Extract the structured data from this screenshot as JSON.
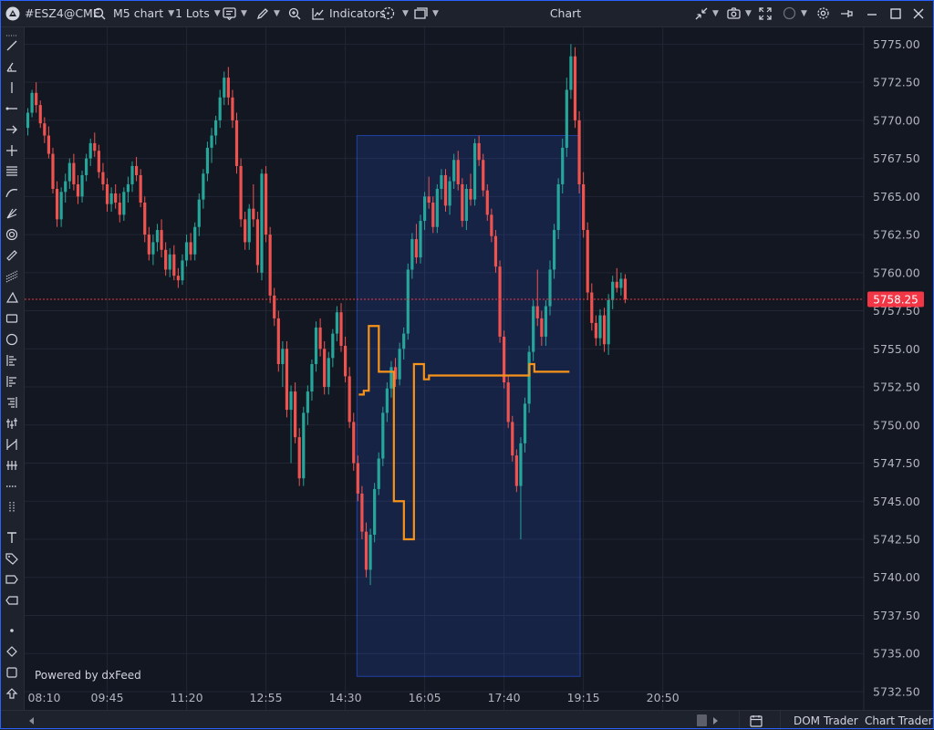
{
  "toolbar": {
    "symbol": "#ESZ4@CME",
    "timeframe": "M5 chart",
    "lots": "1 Lots",
    "indicators": "Indicators",
    "title": "Chart"
  },
  "chart": {
    "last_price_label": "5758.25",
    "powered_by": "Powered by dxFeed"
  },
  "bottom": {
    "dom_trader": "DOM Trader",
    "chart_trader": "Chart Trader"
  },
  "colors": {
    "background": "#131722",
    "up_candle": "#26a69a",
    "down_candle": "#ef5350",
    "highlight_box": "#2962ff",
    "vwap_line": "#f7931a",
    "price_line": "#f23645"
  },
  "icons": [
    "app-logo-icon",
    "search-icon",
    "chevron-down-icon",
    "object-tree-icon",
    "pencil-icon",
    "zoom-icon",
    "indicators-icon",
    "crosshair-icon",
    "layout-icon",
    "collapse-icon",
    "camera-icon",
    "fullscreen-icon",
    "circle-icon",
    "settings-icon",
    "pin-icon",
    "minimize-icon",
    "maximize-icon",
    "close-icon",
    "calendar-icon",
    "scroll-left-icon",
    "scroll-right-icon"
  ],
  "chart_data": {
    "type": "candlestick",
    "y_ticks": [
      "5775.00",
      "5772.50",
      "5770.00",
      "5767.50",
      "5765.00",
      "5762.50",
      "5760.00",
      "5757.50",
      "5755.00",
      "5752.50",
      "5750.00",
      "5747.50",
      "5745.00",
      "5742.50",
      "5740.00",
      "5737.50",
      "5735.00",
      "5732.50"
    ],
    "x_ticks": [
      "08:10",
      "09:45",
      "11:20",
      "12:55",
      "14:30",
      "16:05",
      "17:40",
      "19:15",
      "20:50"
    ],
    "ylim": [
      5731.3,
      5776.1
    ],
    "last_price": 5758.25,
    "highlight_range": {
      "x_start": "14:35",
      "x_end": "19:00",
      "y_top": 5769.0,
      "y_bottom": 5733.5
    },
    "vwap_steps": [
      [
        0,
        5752.0
      ],
      [
        1,
        5752.25
      ],
      [
        2,
        5756.5
      ],
      [
        3,
        5756.5
      ],
      [
        4,
        5753.5
      ],
      [
        6,
        5753.5
      ],
      [
        7,
        5745.0
      ],
      [
        8,
        5745.0
      ],
      [
        9,
        5742.5
      ],
      [
        10,
        5742.5
      ],
      [
        11,
        5754.0
      ],
      [
        12,
        5754.0
      ],
      [
        13,
        5753.0
      ],
      [
        14,
        5753.25
      ],
      [
        17,
        5753.25
      ],
      [
        33,
        5753.25
      ],
      [
        34,
        5754.0
      ],
      [
        35,
        5753.5
      ],
      [
        42,
        5753.5
      ]
    ],
    "vwap_start_index": 121,
    "candles": [
      [
        5769.5,
        5770.8,
        5769.0,
        5770.5
      ],
      [
        5770.5,
        5772.0,
        5770.2,
        5771.8
      ],
      [
        5771.8,
        5772.5,
        5770.5,
        5771.0
      ],
      [
        5771.0,
        5771.3,
        5769.5,
        5769.8
      ],
      [
        5769.8,
        5770.2,
        5768.5,
        5769.0
      ],
      [
        5769.0,
        5769.6,
        5767.5,
        5767.8
      ],
      [
        5767.8,
        5768.2,
        5765.2,
        5765.5
      ],
      [
        5765.5,
        5766.0,
        5763.0,
        5763.5
      ],
      [
        5763.5,
        5765.6,
        5763.0,
        5765.3
      ],
      [
        5765.3,
        5766.5,
        5764.6,
        5766.0
      ],
      [
        5766.0,
        5767.5,
        5765.5,
        5767.2
      ],
      [
        5767.2,
        5767.8,
        5765.4,
        5765.8
      ],
      [
        5765.8,
        5766.4,
        5764.5,
        5765.0
      ],
      [
        5765.0,
        5766.7,
        5764.6,
        5766.4
      ],
      [
        5766.4,
        5767.8,
        5766.0,
        5767.5
      ],
      [
        5767.5,
        5768.8,
        5767.0,
        5768.5
      ],
      [
        5768.5,
        5769.2,
        5767.6,
        5768.0
      ],
      [
        5768.0,
        5768.4,
        5766.2,
        5766.6
      ],
      [
        5766.6,
        5767.2,
        5765.4,
        5765.8
      ],
      [
        5765.8,
        5766.2,
        5764.0,
        5764.5
      ],
      [
        5764.5,
        5765.6,
        5764.0,
        5765.2
      ],
      [
        5765.2,
        5765.8,
        5764.2,
        5764.6
      ],
      [
        5764.6,
        5765.2,
        5763.3,
        5763.8
      ],
      [
        5763.8,
        5765.6,
        5763.4,
        5765.3
      ],
      [
        5765.3,
        5766.3,
        5764.6,
        5765.8
      ],
      [
        5765.8,
        5767.3,
        5765.3,
        5767.0
      ],
      [
        5767.0,
        5767.6,
        5766.0,
        5766.4
      ],
      [
        5766.4,
        5766.8,
        5764.3,
        5764.6
      ],
      [
        5764.6,
        5765.0,
        5762.0,
        5762.5
      ],
      [
        5762.5,
        5763.0,
        5760.8,
        5761.2
      ],
      [
        5761.2,
        5762.5,
        5760.5,
        5762.0
      ],
      [
        5762.0,
        5763.2,
        5761.4,
        5762.8
      ],
      [
        5762.8,
        5763.5,
        5761.0,
        5761.5
      ],
      [
        5761.5,
        5762.0,
        5759.8,
        5760.2
      ],
      [
        5760.2,
        5761.6,
        5759.7,
        5761.2
      ],
      [
        5761.2,
        5761.8,
        5759.5,
        5759.8
      ],
      [
        5759.8,
        5760.3,
        5759.0,
        5759.5
      ],
      [
        5759.5,
        5761.2,
        5759.2,
        5760.8
      ],
      [
        5760.8,
        5762.5,
        5760.4,
        5762.0
      ],
      [
        5762.0,
        5762.6,
        5760.8,
        5761.2
      ],
      [
        5761.2,
        5763.3,
        5760.8,
        5763.0
      ],
      [
        5763.0,
        5765.2,
        5762.4,
        5764.8
      ],
      [
        5764.8,
        5766.8,
        5764.2,
        5766.5
      ],
      [
        5766.5,
        5768.6,
        5766.0,
        5768.2
      ],
      [
        5768.2,
        5769.5,
        5767.2,
        5769.0
      ],
      [
        5769.0,
        5770.3,
        5768.4,
        5770.0
      ],
      [
        5770.0,
        5772.0,
        5769.5,
        5771.5
      ],
      [
        5771.5,
        5773.2,
        5771.0,
        5772.8
      ],
      [
        5772.8,
        5773.5,
        5771.0,
        5771.5
      ],
      [
        5771.5,
        5772.0,
        5769.5,
        5770.0
      ],
      [
        5770.0,
        5770.5,
        5766.5,
        5767.0
      ],
      [
        5767.0,
        5767.5,
        5763.0,
        5763.5
      ],
      [
        5763.5,
        5764.0,
        5761.5,
        5762.0
      ],
      [
        5762.0,
        5764.5,
        5761.5,
        5764.2
      ],
      [
        5764.2,
        5765.8,
        5763.0,
        5763.5
      ],
      [
        5763.5,
        5764.0,
        5760.0,
        5760.5
      ],
      [
        5760.0,
        5766.8,
        5759.5,
        5766.5
      ],
      [
        5766.5,
        5767.0,
        5762.0,
        5762.5
      ],
      [
        5762.5,
        5763.0,
        5758.0,
        5758.5
      ],
      [
        5758.5,
        5759.0,
        5756.5,
        5757.0
      ],
      [
        5757.0,
        5757.5,
        5753.5,
        5754.0
      ],
      [
        5754.0,
        5755.5,
        5752.5,
        5755.0
      ],
      [
        5755.0,
        5755.5,
        5750.5,
        5751.0
      ],
      [
        5751.0,
        5752.6,
        5747.5,
        5752.2
      ],
      [
        5752.2,
        5752.8,
        5748.8,
        5749.2
      ],
      [
        5749.2,
        5749.8,
        5746.0,
        5746.5
      ],
      [
        5746.5,
        5751.2,
        5746.0,
        5750.8
      ],
      [
        5750.8,
        5752.6,
        5750.0,
        5752.2
      ],
      [
        5752.2,
        5754.3,
        5751.6,
        5754.0
      ],
      [
        5754.0,
        5756.8,
        5753.5,
        5756.4
      ],
      [
        5756.4,
        5757.0,
        5754.5,
        5755.0
      ],
      [
        5755.0,
        5755.5,
        5752.0,
        5752.5
      ],
      [
        5752.5,
        5754.8,
        5752.0,
        5754.4
      ],
      [
        5754.4,
        5756.3,
        5753.8,
        5756.0
      ],
      [
        5756.0,
        5757.8,
        5755.5,
        5757.4
      ],
      [
        5757.4,
        5758.0,
        5754.8,
        5755.2
      ],
      [
        5755.2,
        5755.8,
        5752.8,
        5753.2
      ],
      [
        5753.2,
        5753.8,
        5749.8,
        5750.2
      ],
      [
        5750.2,
        5750.8,
        5747.0,
        5747.5
      ],
      [
        5747.5,
        5748.0,
        5745.0,
        5745.5
      ],
      [
        5745.5,
        5746.0,
        5742.5,
        5743.0
      ],
      [
        5743.0,
        5743.6,
        5740.0,
        5740.5
      ],
      [
        5740.5,
        5743.2,
        5739.5,
        5742.8
      ],
      [
        5742.8,
        5746.2,
        5742.3,
        5745.8
      ],
      [
        5745.8,
        5748.2,
        5745.4,
        5747.8
      ],
      [
        5747.8,
        5751.2,
        5747.3,
        5750.8
      ],
      [
        5750.8,
        5752.8,
        5750.2,
        5752.4
      ],
      [
        5752.4,
        5754.2,
        5751.8,
        5753.8
      ],
      [
        5753.8,
        5754.4,
        5752.5,
        5753.0
      ],
      [
        5753.0,
        5755.4,
        5752.6,
        5755.0
      ],
      [
        5755.0,
        5756.4,
        5754.3,
        5756.0
      ],
      [
        5756.0,
        5760.6,
        5755.6,
        5760.2
      ],
      [
        5760.2,
        5762.6,
        5759.6,
        5762.2
      ],
      [
        5762.2,
        5763.2,
        5760.6,
        5761.0
      ],
      [
        5761.0,
        5763.8,
        5760.6,
        5763.4
      ],
      [
        5763.4,
        5765.3,
        5762.8,
        5765.0
      ],
      [
        5765.0,
        5766.3,
        5764.2,
        5764.6
      ],
      [
        5764.6,
        5765.0,
        5762.6,
        5763.0
      ],
      [
        5763.0,
        5765.8,
        5762.6,
        5765.5
      ],
      [
        5765.5,
        5766.8,
        5764.8,
        5766.4
      ],
      [
        5766.4,
        5766.8,
        5764.0,
        5764.4
      ],
      [
        5764.4,
        5766.3,
        5763.8,
        5766.0
      ],
      [
        5766.0,
        5767.8,
        5765.5,
        5767.4
      ],
      [
        5767.4,
        5768.0,
        5765.4,
        5765.8
      ],
      [
        5765.8,
        5766.2,
        5763.0,
        5763.4
      ],
      [
        5763.4,
        5765.8,
        5762.8,
        5765.5
      ],
      [
        5765.5,
        5766.5,
        5764.4,
        5764.8
      ],
      [
        5764.8,
        5768.8,
        5764.4,
        5768.5
      ],
      [
        5768.5,
        5769.0,
        5767.0,
        5767.4
      ],
      [
        5767.4,
        5767.8,
        5765.0,
        5765.4
      ],
      [
        5765.4,
        5765.8,
        5763.4,
        5763.8
      ],
      [
        5763.8,
        5764.2,
        5762.0,
        5762.4
      ],
      [
        5762.4,
        5762.8,
        5760.0,
        5760.4
      ],
      [
        5760.4,
        5760.8,
        5755.4,
        5755.8
      ],
      [
        5755.8,
        5756.2,
        5752.4,
        5752.8
      ],
      [
        5752.8,
        5753.2,
        5749.8,
        5750.2
      ],
      [
        5750.2,
        5750.6,
        5747.6,
        5748.0
      ],
      [
        5748.0,
        5748.4,
        5745.6,
        5746.0
      ],
      [
        5746.0,
        5749.2,
        5742.5,
        5748.8
      ],
      [
        5748.8,
        5751.8,
        5748.2,
        5751.4
      ],
      [
        5751.4,
        5755.2,
        5750.8,
        5754.8
      ],
      [
        5754.8,
        5758.2,
        5754.2,
        5757.8
      ],
      [
        5757.8,
        5760.2,
        5756.5,
        5757.0
      ],
      [
        5757.0,
        5757.5,
        5755.2,
        5755.8
      ],
      [
        5755.8,
        5758.2,
        5755.2,
        5757.8
      ],
      [
        5757.8,
        5760.8,
        5757.2,
        5760.2
      ],
      [
        5760.2,
        5763.2,
        5759.6,
        5762.8
      ],
      [
        5762.8,
        5766.2,
        5762.2,
        5765.8
      ],
      [
        5765.8,
        5768.8,
        5765.2,
        5768.2
      ],
      [
        5768.2,
        5772.8,
        5767.6,
        5772.0
      ],
      [
        5772.0,
        5775.0,
        5771.4,
        5774.2
      ],
      [
        5774.2,
        5774.8,
        5769.5,
        5770.0
      ],
      [
        5770.0,
        5770.6,
        5765.2,
        5765.8
      ],
      [
        5765.8,
        5766.6,
        5762.3,
        5762.8
      ],
      [
        5762.8,
        5763.3,
        5758.2,
        5758.7
      ],
      [
        5758.7,
        5759.3,
        5756.2,
        5756.7
      ],
      [
        5756.7,
        5757.2,
        5755.2,
        5755.7
      ],
      [
        5755.7,
        5757.6,
        5755.2,
        5757.2
      ],
      [
        5757.2,
        5757.7,
        5754.8,
        5755.3
      ],
      [
        5755.3,
        5758.6,
        5754.6,
        5758.2
      ],
      [
        5758.2,
        5759.8,
        5757.6,
        5759.4
      ],
      [
        5759.4,
        5760.3,
        5758.7,
        5759.0
      ],
      [
        5759.0,
        5760.0,
        5758.5,
        5759.6
      ],
      [
        5759.6,
        5759.9,
        5758.0,
        5758.25
      ]
    ]
  }
}
